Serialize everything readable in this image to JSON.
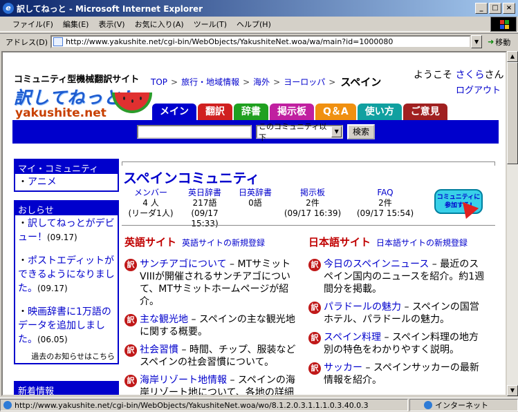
{
  "window": {
    "title": "訳してねっと - Microsoft Internet Explorer"
  },
  "menu": [
    "ファイル(F)",
    "編集(E)",
    "表示(V)",
    "お気に入り(A)",
    "ツール(T)",
    "ヘルプ(H)"
  ],
  "address": {
    "label": "アドレス(D)",
    "url": "http://www.yakushite.net/cgi-bin/WebObjects/YakushiteNet.woa/wa/main?id=1000080",
    "go": "移動"
  },
  "site": {
    "tagline": "コミュニティ型機械翻訳サイト",
    "logo": "訳してねっと！",
    "domain": "yakushite.net"
  },
  "breadcrumb": {
    "items": [
      "TOP",
      "旅行・地域情報",
      "海外",
      "ヨーロッパ"
    ],
    "current": "スペイン"
  },
  "user": {
    "welcome_prefix": "ようこそ",
    "name": "さくら",
    "suffix": "さん",
    "logout": "ログアウト"
  },
  "tabs": [
    {
      "label": "メイン",
      "color": "#0000cc"
    },
    {
      "label": "翻訳",
      "color": "#d02020"
    },
    {
      "label": "辞書",
      "color": "#20a020"
    },
    {
      "label": "掲示板",
      "color": "#c020a0"
    },
    {
      "label": "Q＆A",
      "color": "#f09010"
    },
    {
      "label": "使い方",
      "color": "#10a0a0"
    },
    {
      "label": "ご意見",
      "color": "#a02020"
    }
  ],
  "search": {
    "scope": "このコミュニティ以下",
    "button": "検索"
  },
  "my_community": {
    "title": "マイ・コミュニティ",
    "items": [
      "アニメ"
    ]
  },
  "news": {
    "title": "おしらせ",
    "items": [
      {
        "text": "訳してねっとがデビュー！",
        "date": "(09.17)"
      },
      {
        "text": "ポストエディットができるようになりました。",
        "date": "(09.17)"
      },
      {
        "text": "映画辞書に1万語のデータを追加しました。",
        "date": "(06.05)"
      }
    ],
    "more": "過去のお知らせはこちら"
  },
  "new_info": {
    "title": "新着情報"
  },
  "community": {
    "title": "スペインコミュニティ",
    "stats": [
      {
        "label": "メンバー",
        "value": "4 人",
        "sub": "(リーダ1人)"
      },
      {
        "label": "英日辞書",
        "value": "217語",
        "sub": "(09/17 15:33)"
      },
      {
        "label": "日英辞書",
        "value": "0語",
        "sub": ""
      },
      {
        "label": "掲示板",
        "value": "2件",
        "sub": "(09/17 16:39)"
      },
      {
        "label": "FAQ",
        "value": "2件",
        "sub": "(09/17 15:54)"
      }
    ],
    "join_button": "コミュニティに参加する!"
  },
  "english_sites": {
    "title": "英語サイト",
    "register": "英語サイトの新規登録",
    "items": [
      {
        "link": "サンチアゴについて",
        "desc": " – MTサミットVIIIが開催されるサンチアゴについて、MTサミットホームページが紹介。"
      },
      {
        "link": "主な観光地",
        "desc": " – スペインの主な観光地に関する概要。"
      },
      {
        "link": "社会習慣",
        "desc": " – 時間、チップ、服装などスペインの社会習慣について。"
      },
      {
        "link": "海岸リゾート地情報",
        "desc": " – スペインの海岸リゾート地について、各地の詳細"
      }
    ]
  },
  "japanese_sites": {
    "title": "日本語サイト",
    "register": "日本語サイトの新規登録",
    "items": [
      {
        "link": "今日のスペインニュース",
        "desc": " – 最近のスペイン国内のニュースを紹介。約1週間分を掲載。"
      },
      {
        "link": "パラドールの魅力",
        "desc": " – スペインの国営ホテル、パラドールの魅力。"
      },
      {
        "link": "スペイン料理",
        "desc": " – スペイン料理の地方別の特色をわかりやすく説明。"
      },
      {
        "link": "サッカー",
        "desc": " – スペインサッカーの最新情報を紹介。"
      }
    ]
  },
  "badge": "訳",
  "status": {
    "text": "http://www.yakushite.net/cgi-bin/WebObjects/YakushiteNet.woa/wo/8.1.2.0.3.1.1.1.0.3.40.0.3",
    "zone": "インターネット"
  }
}
